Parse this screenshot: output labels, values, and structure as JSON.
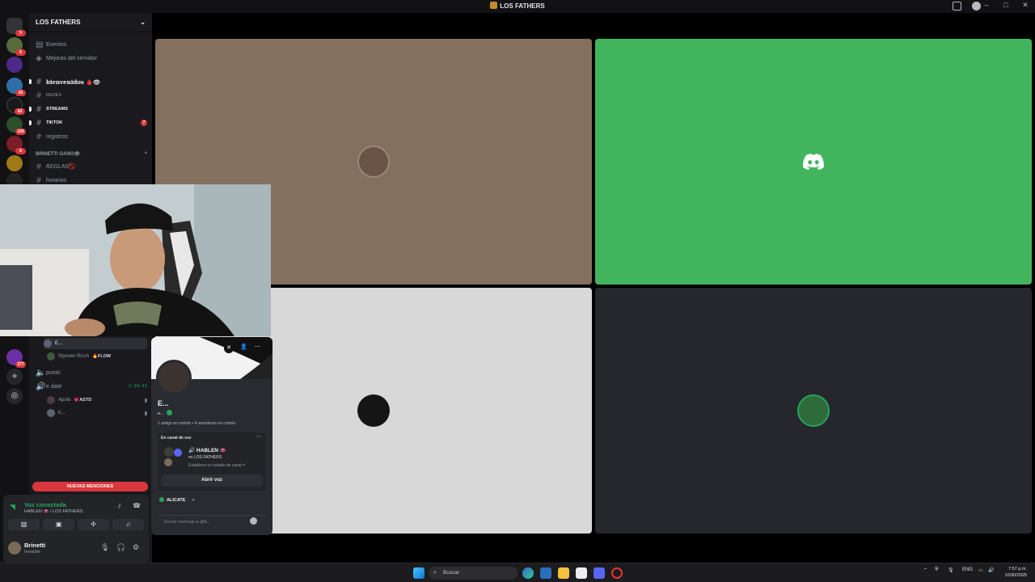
{
  "window": {
    "title": "LOS FATHERS",
    "controls": [
      "–",
      "□",
      "✕"
    ]
  },
  "server": {
    "name": "LOS FATHERS",
    "nav": [
      {
        "label": "Eventos",
        "icon": "calendar-icon"
      },
      {
        "label": "Mejoras del servidor",
        "icon": "boost-icon"
      }
    ],
    "channels": [
      {
        "name": "bienvenidos 🩸👁",
        "bold": true
      },
      {
        "name": "REDES",
        "bold": false
      },
      {
        "name": "STREAMS",
        "bold": true
      },
      {
        "name": "TIKTOK",
        "bold": true,
        "count": "7"
      },
      {
        "name": "registros",
        "bold": false
      }
    ],
    "category": "BRINETTI GANG👁",
    "category_channels": [
      {
        "name": "𝘙𝘌𝘎𝘓𝘈𝘚🚫"
      },
      {
        "name": "horarios"
      }
    ],
    "rail_badges": [
      "5",
      "5",
      "43",
      "62",
      "193",
      "6",
      "277"
    ]
  },
  "voice_section": {
    "members_top": [
      {
        "name": "E..."
      },
      {
        "name": "Styvven Ricch",
        "tag": "🔥FLOW"
      }
    ],
    "channels": [
      {
        "name": "punto"
      },
      {
        "name": "e date",
        "timer": "1:24:31"
      }
    ],
    "members_bottom": [
      {
        "name": "Apolo",
        "tag": "💗ASTD"
      },
      {
        "name": "K..."
      }
    ],
    "mentions_label": "NUEVAS MENCIONES"
  },
  "voice_panel": {
    "status": "Voz conectada",
    "location": "HABLEN 👄 / LOS FATHERS"
  },
  "user_panel": {
    "name": "Brinetti",
    "status": "Invisible"
  },
  "profile_popup": {
    "name": "E...",
    "username": "e...",
    "mutual": "1 amigo en común • 4 servidores en común",
    "voice_label": "En canal de voz",
    "voice_channel": "🔊 HABLEN 👄",
    "voice_server": "en LOS FATHERS",
    "voice_status_hint": "Establece un estado de canal ✏",
    "open_voice": "Abrir voz",
    "activity": "ALICATE",
    "message_placeholder": "Enviar mensaje a @E..."
  },
  "stage": {
    "tiles": [
      {
        "bg": "#83705f"
      },
      {
        "bg": "#43b45e"
      },
      {
        "bg": "#d9d8d8"
      },
      {
        "bg": "#26272c"
      }
    ]
  },
  "taskbar": {
    "search": "Buscar",
    "lang": "ENG",
    "time": "7:57 p.m.",
    "date": "10/30/2025"
  },
  "colors": {
    "accent_red": "#da373c",
    "online_green": "#23a55a",
    "blurple": "#5865f2"
  }
}
